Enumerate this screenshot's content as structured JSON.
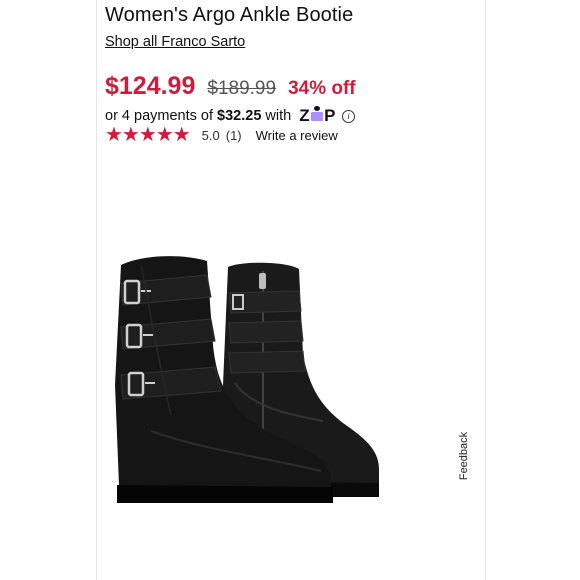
{
  "product": {
    "title": "Women's Argo Ankle Bootie",
    "brand_link": "Shop all Franco Sarto",
    "image_alt": "black ankle boots with buckle straps"
  },
  "pricing": {
    "current": "$124.99",
    "original": "$189.99",
    "discount": "34% off"
  },
  "installments": {
    "prefix": "or 4 payments of",
    "amount": "$32.25",
    "suffix": "with",
    "provider": "Zip",
    "info_icon": "info-icon"
  },
  "rating": {
    "stars": "★★★★★",
    "score": "5.0",
    "count": "(1)",
    "write_review": "Write a review"
  },
  "feedback": {
    "label": "Feedback"
  },
  "colors": {
    "price_red": "#d21a3a",
    "zip_purple": "#aa8fff",
    "zip_dark": "#1a0826"
  }
}
